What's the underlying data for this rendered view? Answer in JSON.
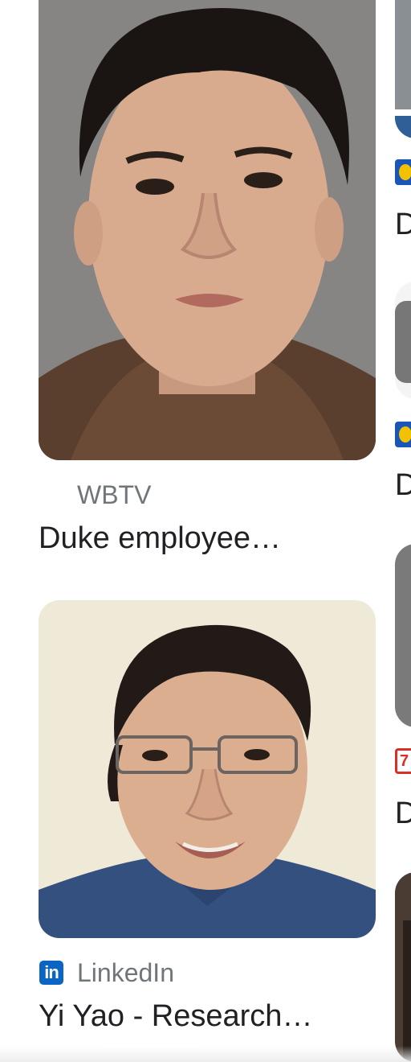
{
  "results": [
    {
      "source": "WBTV",
      "source_icon": "none",
      "title": "Duke employee…",
      "image_alt": "photo-man-mugshot"
    },
    {
      "source": "LinkedIn",
      "source_icon": "linkedin-icon",
      "source_badge_text": "in",
      "title": "Yi Yao - Research…",
      "image_alt": "photo-man-glasses"
    }
  ],
  "right_column": {
    "title_letters": [
      "D",
      "D",
      "D"
    ],
    "favicon_colors": [
      "#1a56b8",
      "#1a56b8",
      "#d93025"
    ]
  },
  "colors": {
    "linkedin": "#0a66c2",
    "source_text": "#70757a",
    "title_text": "#202124"
  }
}
